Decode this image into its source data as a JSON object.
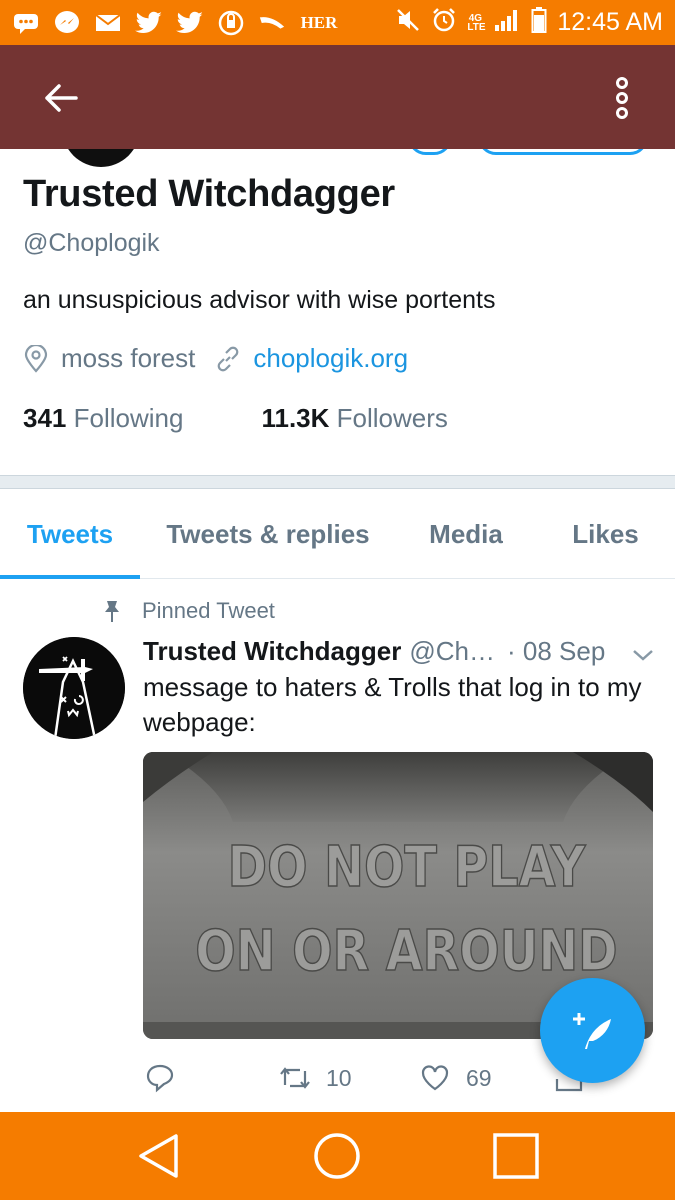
{
  "status_bar": {
    "time": "12:45 AM",
    "network_label": "4G LTE",
    "notification_icons": [
      "chat-bubble-icon",
      "messenger-icon",
      "mail-icon",
      "twitter-icon",
      "twitter-icon",
      "vpn-icon",
      "signal-wave-icon",
      "her-app-icon"
    ],
    "her_text": "HER"
  },
  "app_bar": {
    "color": "#743433"
  },
  "profile": {
    "display_name": "Trusted Witchdagger",
    "handle": "@Choplogik",
    "bio": "an unsuspicious advisor with wise portents",
    "location": "moss forest",
    "website": "choplogik.org",
    "following_count": "341",
    "following_label": "Following",
    "followers_count": "11.3K",
    "followers_label": "Followers"
  },
  "tabs": [
    {
      "label": "Tweets",
      "active": true
    },
    {
      "label": "Tweets & replies",
      "active": false
    },
    {
      "label": "Media",
      "active": false
    },
    {
      "label": "Likes",
      "active": false
    }
  ],
  "tweet": {
    "pinned_label": "Pinned Tweet",
    "author_name": "Trusted Witchdagger",
    "author_handle": "@Ch…",
    "date": "· 08 Sep",
    "text": "message to haters & Trolls that log in to my webpage:",
    "media_text_line1": "DO NOT PLAY",
    "media_text_line2": "ON OR AROUND",
    "retweet_count": "10",
    "like_count": "69"
  },
  "colors": {
    "system_bar": "#f57c00",
    "accent": "#1da1f2",
    "link": "#1b95e0",
    "secondary_text": "#657786"
  }
}
